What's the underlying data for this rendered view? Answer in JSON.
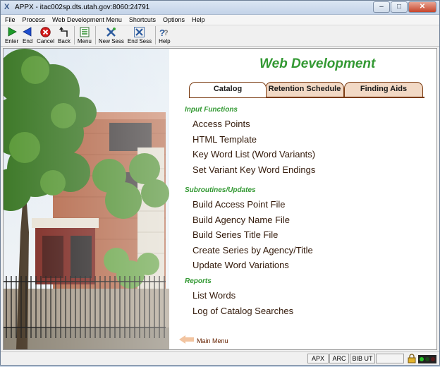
{
  "window": {
    "title": "APPX - itac002sp.dts.utah.gov:8060:24791",
    "controls": [
      "–",
      "□",
      "✕"
    ]
  },
  "menubar": [
    "File",
    "Process",
    "Web Development Menu",
    "Shortcuts",
    "Options",
    "Help"
  ],
  "toolbar": [
    {
      "label": "Enter",
      "icon": "play-icon"
    },
    {
      "label": "End",
      "icon": "back-arrow-icon"
    },
    {
      "label": "Cancel",
      "icon": "cancel-icon"
    },
    {
      "label": "Back",
      "icon": "back-step-icon"
    },
    {
      "label": "Menu",
      "icon": "menu-icon"
    },
    {
      "label": "New Sess",
      "icon": "new-session-icon"
    },
    {
      "label": "End Sess",
      "icon": "end-session-icon"
    },
    {
      "label": "Help",
      "icon": "help-icon"
    }
  ],
  "panel": {
    "heading": "Web Development",
    "tabs": [
      {
        "label": "Catalog",
        "active": true
      },
      {
        "label": "Retention Schedule",
        "active": false
      },
      {
        "label": "Finding Aids",
        "active": false
      }
    ],
    "sections": [
      {
        "title": "Input Functions",
        "items": [
          "Access Points",
          "HTML Template",
          "Key Word List (Word Variants)",
          "Set Variant Key Word Endings"
        ]
      },
      {
        "title": "Subroutines/Updates",
        "items": [
          "Build Access Point File",
          "Build Agency Name File",
          "Build Series Title File",
          "Create Series by Agency/Title",
          "Update Word Variations"
        ]
      },
      {
        "title": "Reports",
        "items": [
          "List Words",
          "Log of Catalog Searches"
        ]
      }
    ],
    "main_menu": "Main Menu"
  },
  "statusbar": [
    "APX",
    "ARC",
    "BIB UT"
  ],
  "colors": {
    "heading": "#339933",
    "tab_border": "#7a3b12",
    "inactive_tab": "#f2d9c5",
    "item_text": "#331a0a"
  }
}
